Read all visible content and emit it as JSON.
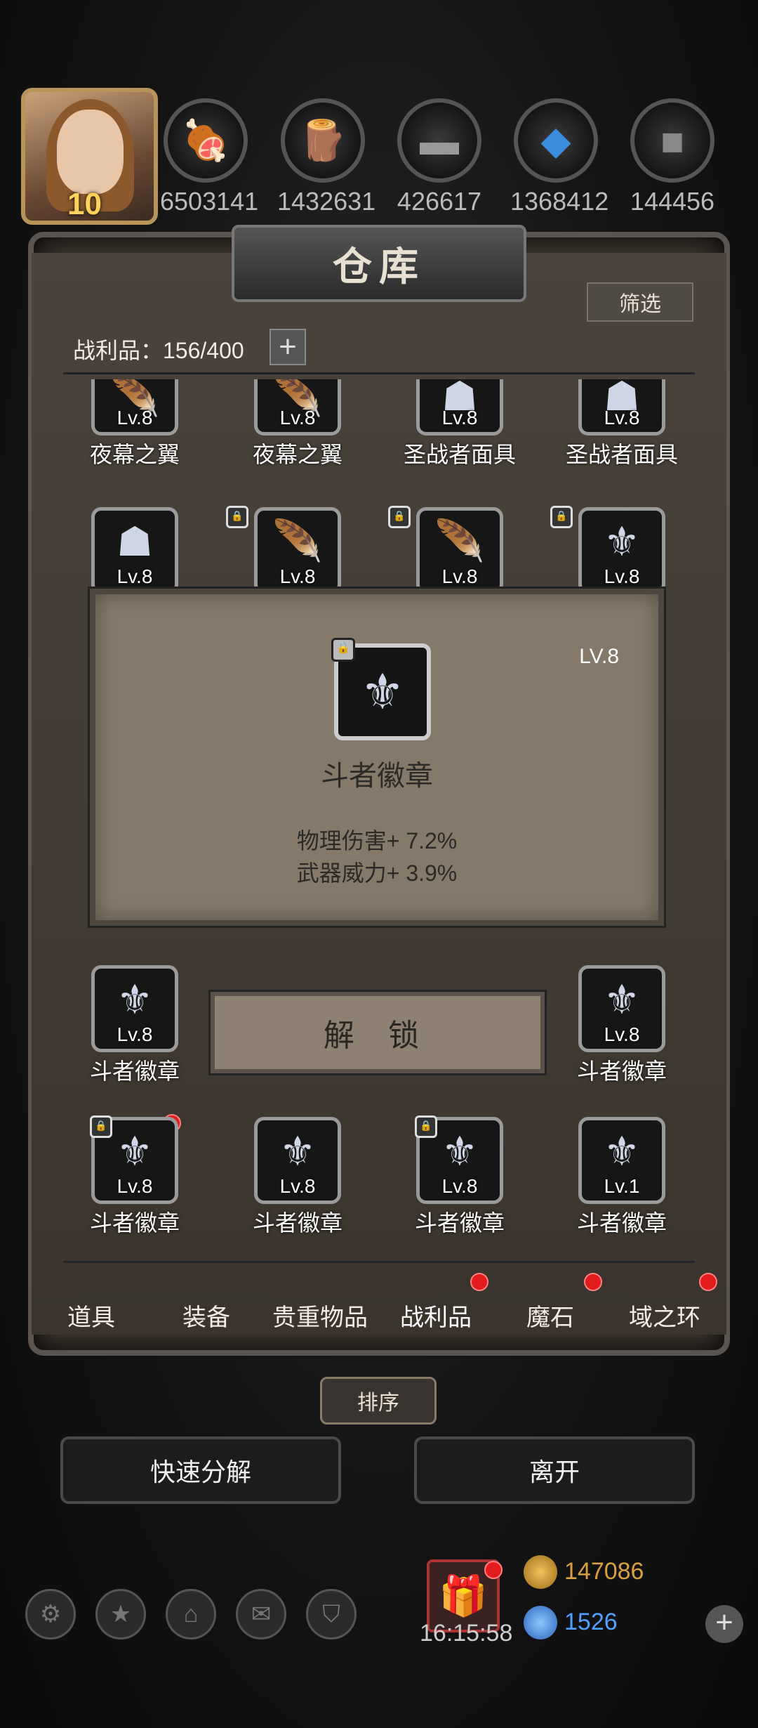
{
  "player": {
    "level": "10"
  },
  "resources": [
    {
      "icon": "meat-icon",
      "value": "6503141"
    },
    {
      "icon": "wood-icon",
      "value": "1432631"
    },
    {
      "icon": "iron-icon",
      "value": "426617"
    },
    {
      "icon": "crystal-icon",
      "value": "1368412"
    },
    {
      "icon": "stone-icon",
      "value": "144456"
    }
  ],
  "warehouse": {
    "title": "仓库",
    "filter_label": "筛选",
    "loot_label": "战利品：156/400",
    "plus_label": "+"
  },
  "grid": {
    "row1": [
      {
        "name": "夜幕之翼",
        "level": "Lv.8"
      },
      {
        "name": "夜幕之翼",
        "level": "Lv.8"
      },
      {
        "name": "圣战者面具",
        "level": "Lv.8"
      },
      {
        "name": "圣战者面具",
        "level": "Lv.8"
      }
    ],
    "row2": [
      {
        "level": "Lv.8"
      },
      {
        "level": "Lv.8"
      },
      {
        "level": "Lv.8"
      },
      {
        "level": "Lv.8"
      }
    ],
    "row5": [
      {
        "name": "斗者徽章",
        "level": "Lv.8"
      },
      {
        "name": "斗者徽章",
        "level": "Lv.8"
      }
    ],
    "row6": [
      {
        "name": "斗者徽章",
        "level": "Lv.8"
      },
      {
        "name": "斗者徽章",
        "level": "Lv.8"
      },
      {
        "name": "斗者徽章",
        "level": "Lv.8"
      },
      {
        "name": "斗者徽章",
        "level": "Lv.1"
      }
    ]
  },
  "popup": {
    "level": "LV.8",
    "name": "斗者徽章",
    "stat1": "物理伤害+ 7.2%",
    "stat2": "武器威力+ 3.9%"
  },
  "unlock_label": "解 锁",
  "tabs": [
    "道具",
    "装备",
    "贵重物品",
    "战利品",
    "魔石",
    "域之环"
  ],
  "sort_label": "排序",
  "quick_decompose_label": "快速分解",
  "leave_label": "离开",
  "bottom": {
    "timer": "16:15:58",
    "gold": "147086",
    "gems": "1526"
  },
  "colors": {
    "gold": "#d8a040",
    "gem": "#4fa0ff",
    "reddot": "#e21c1c"
  }
}
